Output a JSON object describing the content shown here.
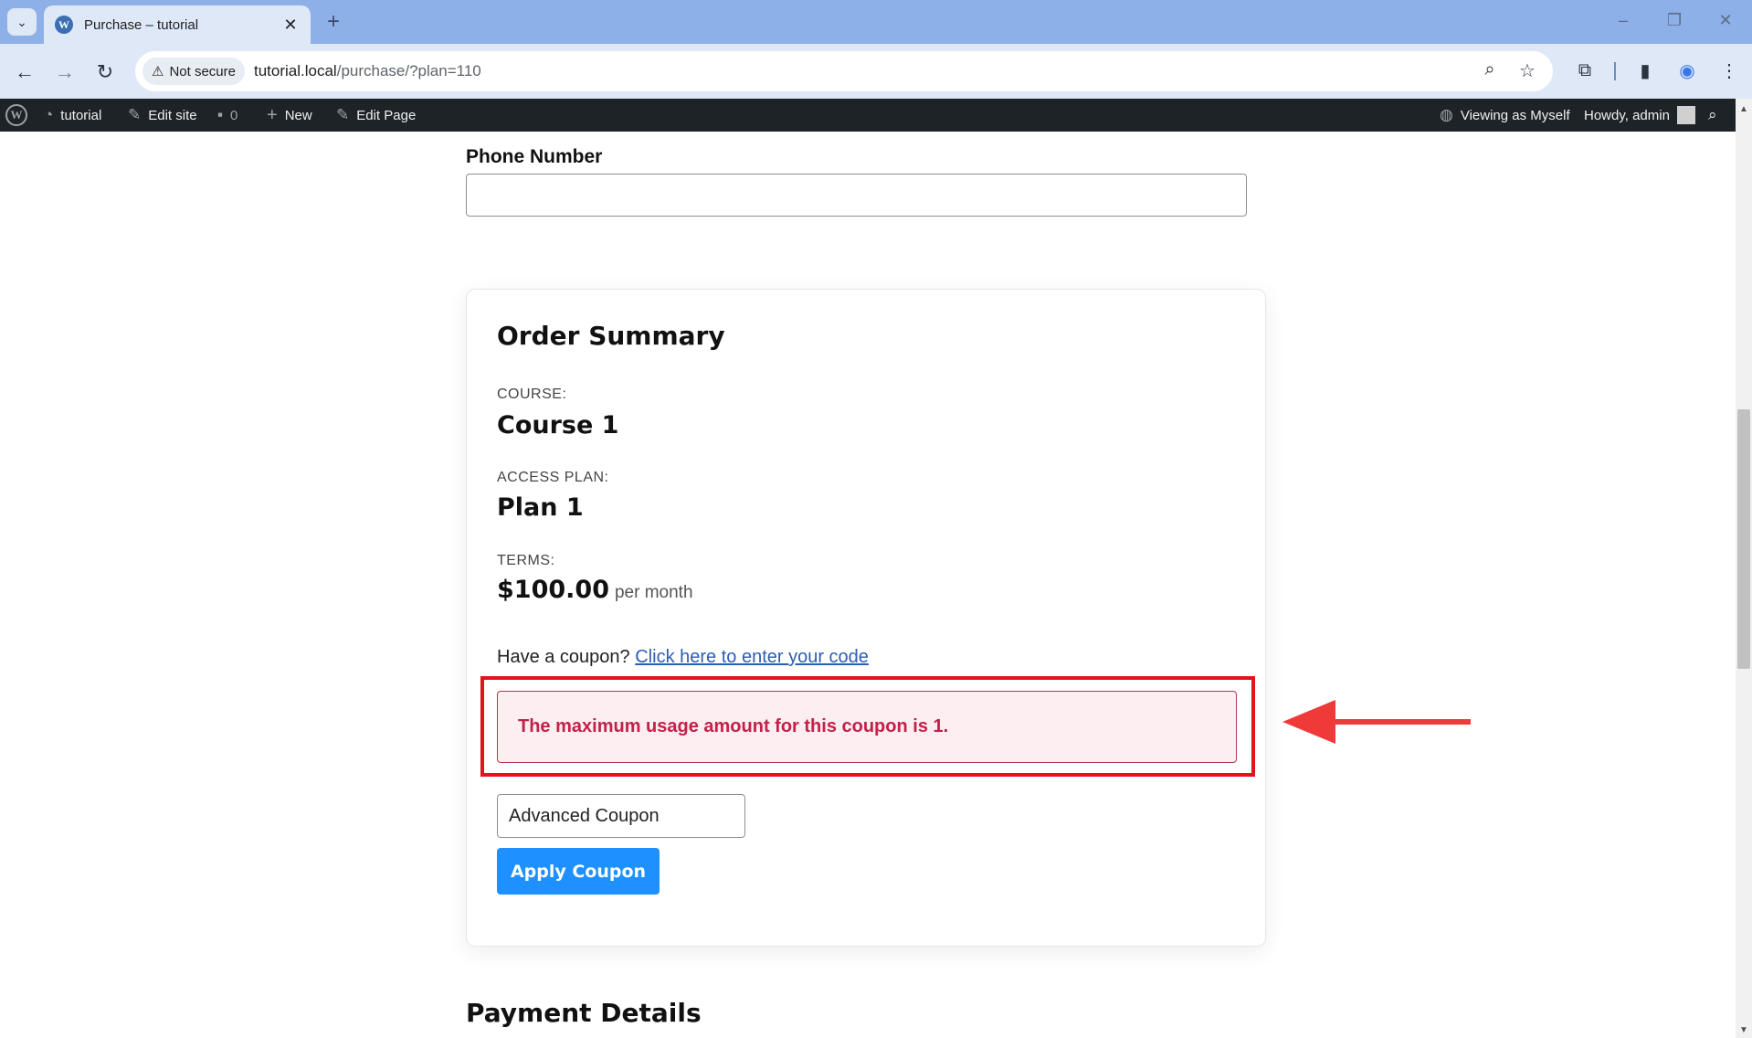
{
  "browser": {
    "tab_title": "Purchase – tutorial",
    "url_host": "tutorial.local",
    "url_path": "/purchase/?plan=110",
    "security_label": "Not secure"
  },
  "adminbar": {
    "site_name": "tutorial",
    "edit_site": "Edit site",
    "comments_count": "0",
    "new_label": "New",
    "edit_page": "Edit Page",
    "viewing_as": "Viewing as Myself",
    "howdy": "Howdy, admin"
  },
  "form": {
    "phone_label": "Phone Number",
    "phone_value": ""
  },
  "order_summary": {
    "title": "Order Summary",
    "course_label": "COURSE:",
    "course_value": "Course 1",
    "plan_label": "ACCESS PLAN:",
    "plan_value": "Plan 1",
    "terms_label": "TERMS:",
    "price": "$100.00",
    "price_period": "per month",
    "coupon_prompt": "Have a coupon?",
    "coupon_link": "Click here to enter your code",
    "error_message": "The maximum usage amount for this coupon is 1.",
    "coupon_value": "Advanced Coupon",
    "apply_button": "Apply Coupon"
  },
  "payment": {
    "title": "Payment Details"
  },
  "colors": {
    "highlight": "#e3121b",
    "error_text": "#c3204a",
    "button": "#1e90ff"
  }
}
